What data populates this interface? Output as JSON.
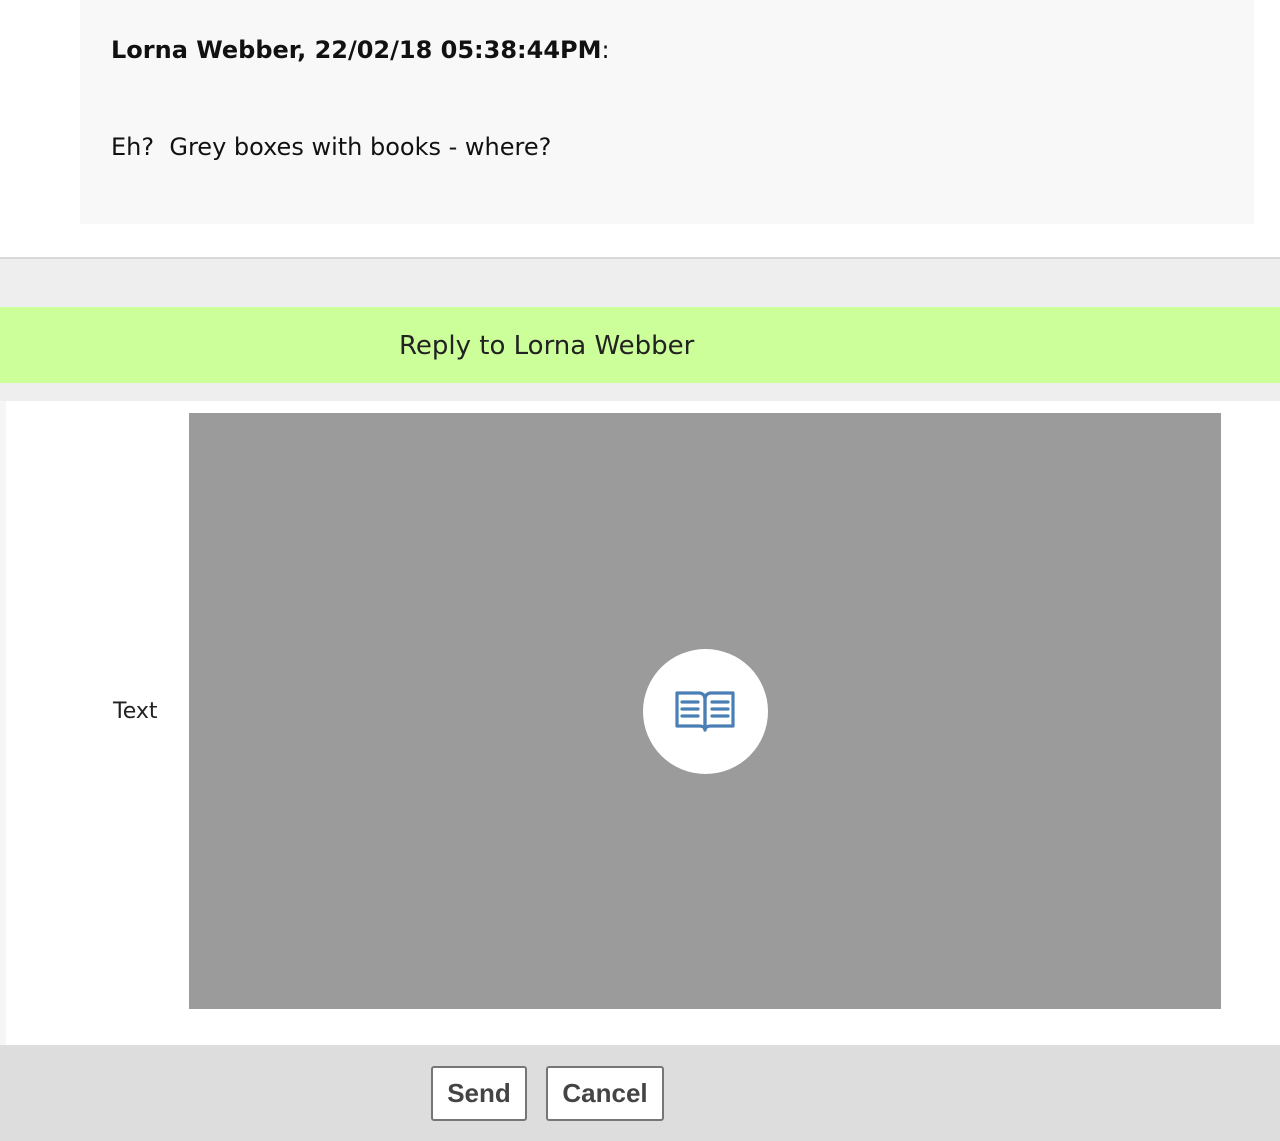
{
  "message": {
    "author_line": "Lorna Webber, 22/02/18 05:38:44PM",
    "author_suffix": ":",
    "body": "Eh?  Grey boxes with books - where?"
  },
  "reply": {
    "title": "Reply to Lorna Webber"
  },
  "form": {
    "text_label": "Text",
    "editor_icon": "open-book-icon",
    "editor_bg_color": "#9b9b9b",
    "icon_color": "#4a7fb5"
  },
  "actions": {
    "send_label": "Send",
    "cancel_label": "Cancel"
  },
  "colors": {
    "reply_header_bg": "#ccff99",
    "message_card_bg": "#f8f8f8",
    "actions_bar_bg": "#dddddd"
  }
}
